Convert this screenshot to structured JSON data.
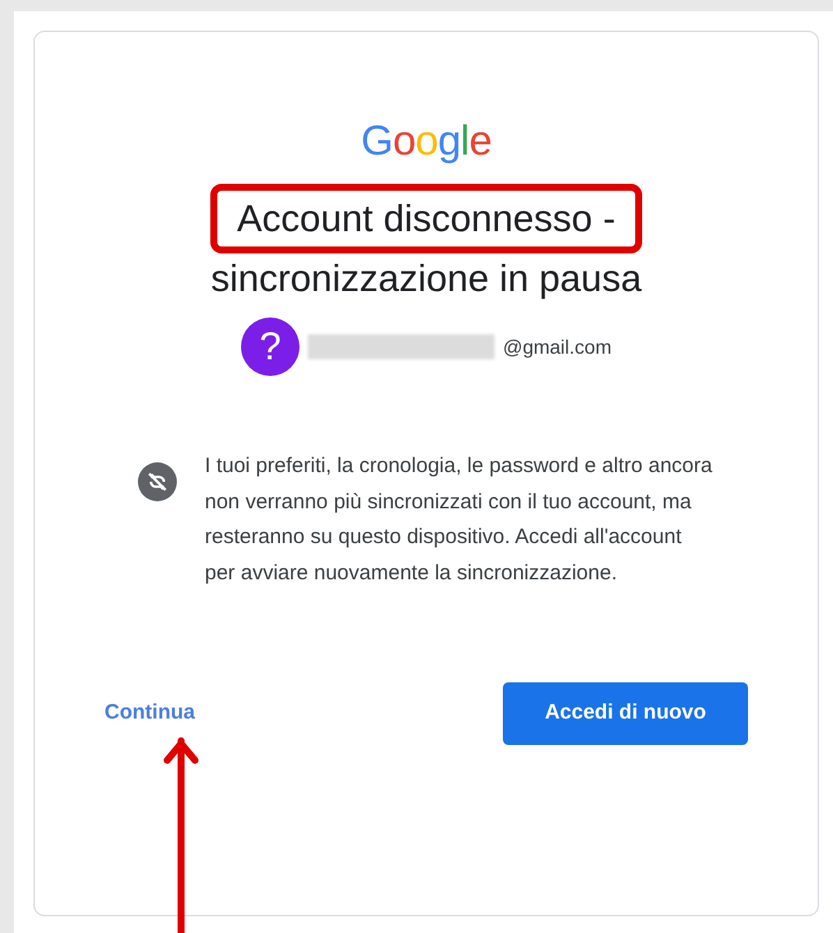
{
  "logo": "Google",
  "title_lines": [
    {
      "text": "Account disconnesso -",
      "highlighted": true
    },
    {
      "text": "sincronizzazione in pausa",
      "highlighted": false
    }
  ],
  "account": {
    "avatar": "?",
    "email_domain": "@gmail.com",
    "email_redacted": true
  },
  "message": "I tuoi preferiti, la cronologia, le password e altro ancora non verranno più sincronizzati con il tuo account, ma resteranno su questo dispositivo. Accedi all'account per avviare nuovamente la sincronizzazione.",
  "continue_link": {
    "label": "Continua",
    "arrow": true
  },
  "sign_in_button": {
    "label": "Accedi di nuovo"
  }
}
